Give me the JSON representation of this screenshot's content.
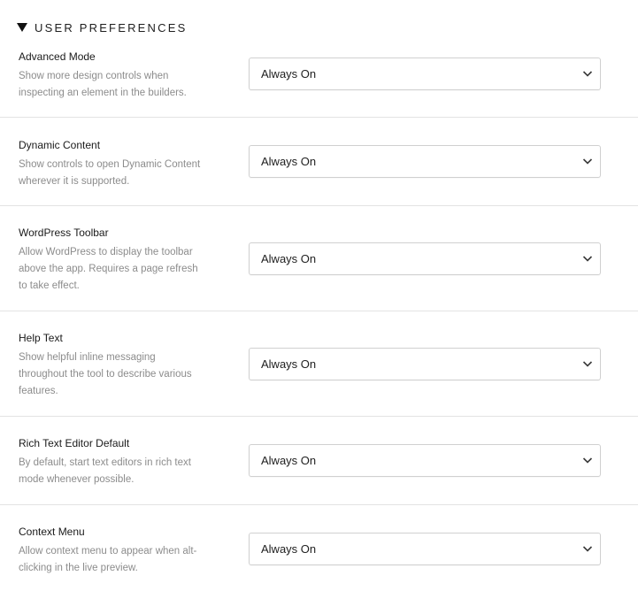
{
  "section": {
    "title": "USER PREFERENCES",
    "icon": "caret-down-icon"
  },
  "preferences": [
    {
      "label": "Advanced Mode",
      "description": "Show more design controls when inspecting an element in the builders.",
      "value": "Always On"
    },
    {
      "label": "Dynamic Content",
      "description": "Show controls to open Dynamic Content wherever it is supported.",
      "value": "Always On"
    },
    {
      "label": "WordPress Toolbar",
      "description": "Allow WordPress to display the toolbar above the app. Requires a page refresh to take effect.",
      "value": "Always On"
    },
    {
      "label": "Help Text",
      "description": "Show helpful inline messaging throughout the tool to describe various features.",
      "value": "Always On"
    },
    {
      "label": "Rich Text Editor Default",
      "description": "By default, start text editors in rich text mode whenever possible.",
      "value": "Always On"
    },
    {
      "label": "Context Menu",
      "description": "Allow context menu to appear when alt-clicking in the live preview.",
      "value": "Always On"
    }
  ],
  "select_icon": "chevron-down-icon"
}
